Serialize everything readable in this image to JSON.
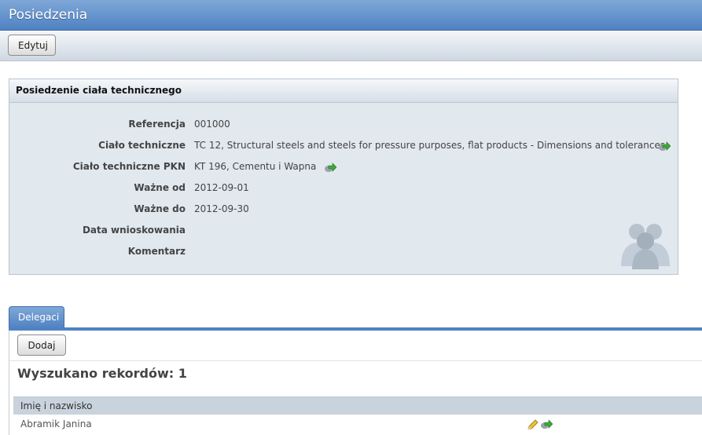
{
  "app": {
    "title": "Posiedzenia"
  },
  "toolbar": {
    "edit_label": "Edytuj"
  },
  "panel": {
    "title": "Posiedzenie ciała technicznego",
    "fields": [
      {
        "label": "Referencja",
        "value": "001000"
      },
      {
        "label": "Ciało techniczne",
        "value": "TC 12, Structural steels and steels for pressure purposes, flat products - Dimensions and tolerances",
        "icon": "go-link-icon"
      },
      {
        "label": "Ciało techniczne PKN",
        "value": "KT 196, Cementu i Wapna",
        "icon": "go-link-icon"
      },
      {
        "label": "Ważne od",
        "value": "2012-09-01"
      },
      {
        "label": "Ważne do",
        "value": "2012-09-30"
      },
      {
        "label": "Data wnioskowania",
        "value": ""
      },
      {
        "label": "Komentarz",
        "value": ""
      }
    ],
    "decor_icon": "people-icon"
  },
  "tabs": [
    {
      "label": "Delegaci",
      "active": true
    }
  ],
  "delegates": {
    "add_label": "Dodaj",
    "records_found": "Wyszukano rekordów: 1",
    "columns": [
      "Imię i nazwisko"
    ],
    "rows": [
      {
        "name": "Abramik Janina",
        "actions": [
          "pencil-icon",
          "go-link-icon"
        ]
      }
    ]
  },
  "colors": {
    "header_blue": "#4f82c2",
    "panel_bg": "#e1e8ee",
    "grid_header": "#c9d3dd"
  }
}
